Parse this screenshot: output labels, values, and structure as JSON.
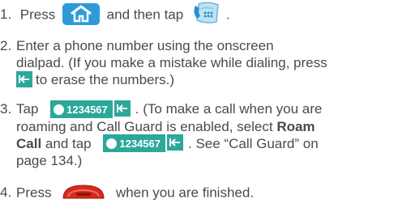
{
  "steps": [
    {
      "num": "1.",
      "pre": "Press",
      "mid": "and then tap",
      "post": "."
    },
    {
      "num": "2.",
      "line1": "Enter a phone number using the onscreen",
      "line2": "dialpad. (If you make a mistake while dialing, press",
      "line3": "to erase the numbers.)"
    },
    {
      "num": "3.",
      "pre": "Tap",
      "after": ". (To make a call when you are",
      "line2a": "roaming and Call Guard is enabled, select",
      "roam": "Roam",
      "call": "Call",
      "line3a": "and tap",
      "line3b": ". See “Call Guard” on",
      "line4": "page 134.)"
    },
    {
      "num": "4.",
      "pre": "Press",
      "post": "when you are finished."
    }
  ],
  "call_button": {
    "number": "1234567"
  },
  "icons": {
    "home": "home-icon",
    "phone": "phone-app-icon",
    "backspace": "backspace-icon",
    "end": "end-call-icon"
  },
  "colors": {
    "text": "#4a4a4a",
    "home_bg": "#2e9bd8",
    "teal": "#2ba89a",
    "end_red": "#d42a1e"
  }
}
